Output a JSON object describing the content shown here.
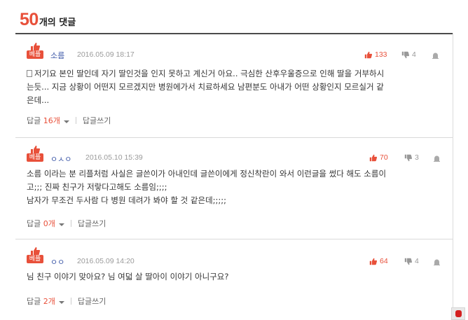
{
  "header": {
    "count": "50",
    "count_suffix": "개의 댓글"
  },
  "colors": {
    "accent": "#e8503a",
    "author": "#3d58a8"
  },
  "comments": [
    {
      "badge": "베플",
      "author": "소름",
      "date": "2016.05.09 18:17",
      "likes": "133",
      "dislikes": "4",
      "body_lines": [
        "저기요 본인 딸인데 자기 딸인것을 인지 못하고 계신거 아요.. 극심한 산후우울증으로 인해 딸을 거부하시",
        "는듯... 지금 상황이 어떤지 모르겠지만 병원에가서 치료하세요 남편분도 아내가 어떤 상황인지 모르실거 같",
        "은데..."
      ],
      "reply_label": "답글",
      "reply_count": "16개",
      "write_label": "답글쓰기"
    },
    {
      "badge": "베플",
      "author": "ㅇㅅㅇ",
      "date": "2016.05.10 15:39",
      "likes": "70",
      "dislikes": "3",
      "body_lines": [
        "소름 이라는 분 리플처럼 사실은 글쓴이가 아내인데 글쓴이에게 정신착란이 와서 이런글을 썼다 해도 소름이",
        "고;;; 진짜 친구가 저랗다고해도 소름임;;;;",
        "남자가 무조건 두사람 다 병원 데려가 봐야 할 것 같은데;;;;;"
      ],
      "reply_label": "답글",
      "reply_count": "0개",
      "write_label": "답글쓰기"
    },
    {
      "badge": "베플",
      "author": "ㅇㅇ",
      "date": "2016.05.09 14:20",
      "likes": "64",
      "dislikes": "4",
      "body_lines": [
        "님 친구 이야기 맞아요? 님 여덟 살 딸아이 이야기 아니구요?"
      ],
      "reply_label": "답글",
      "reply_count": "2개",
      "write_label": "답글쓰기"
    }
  ]
}
